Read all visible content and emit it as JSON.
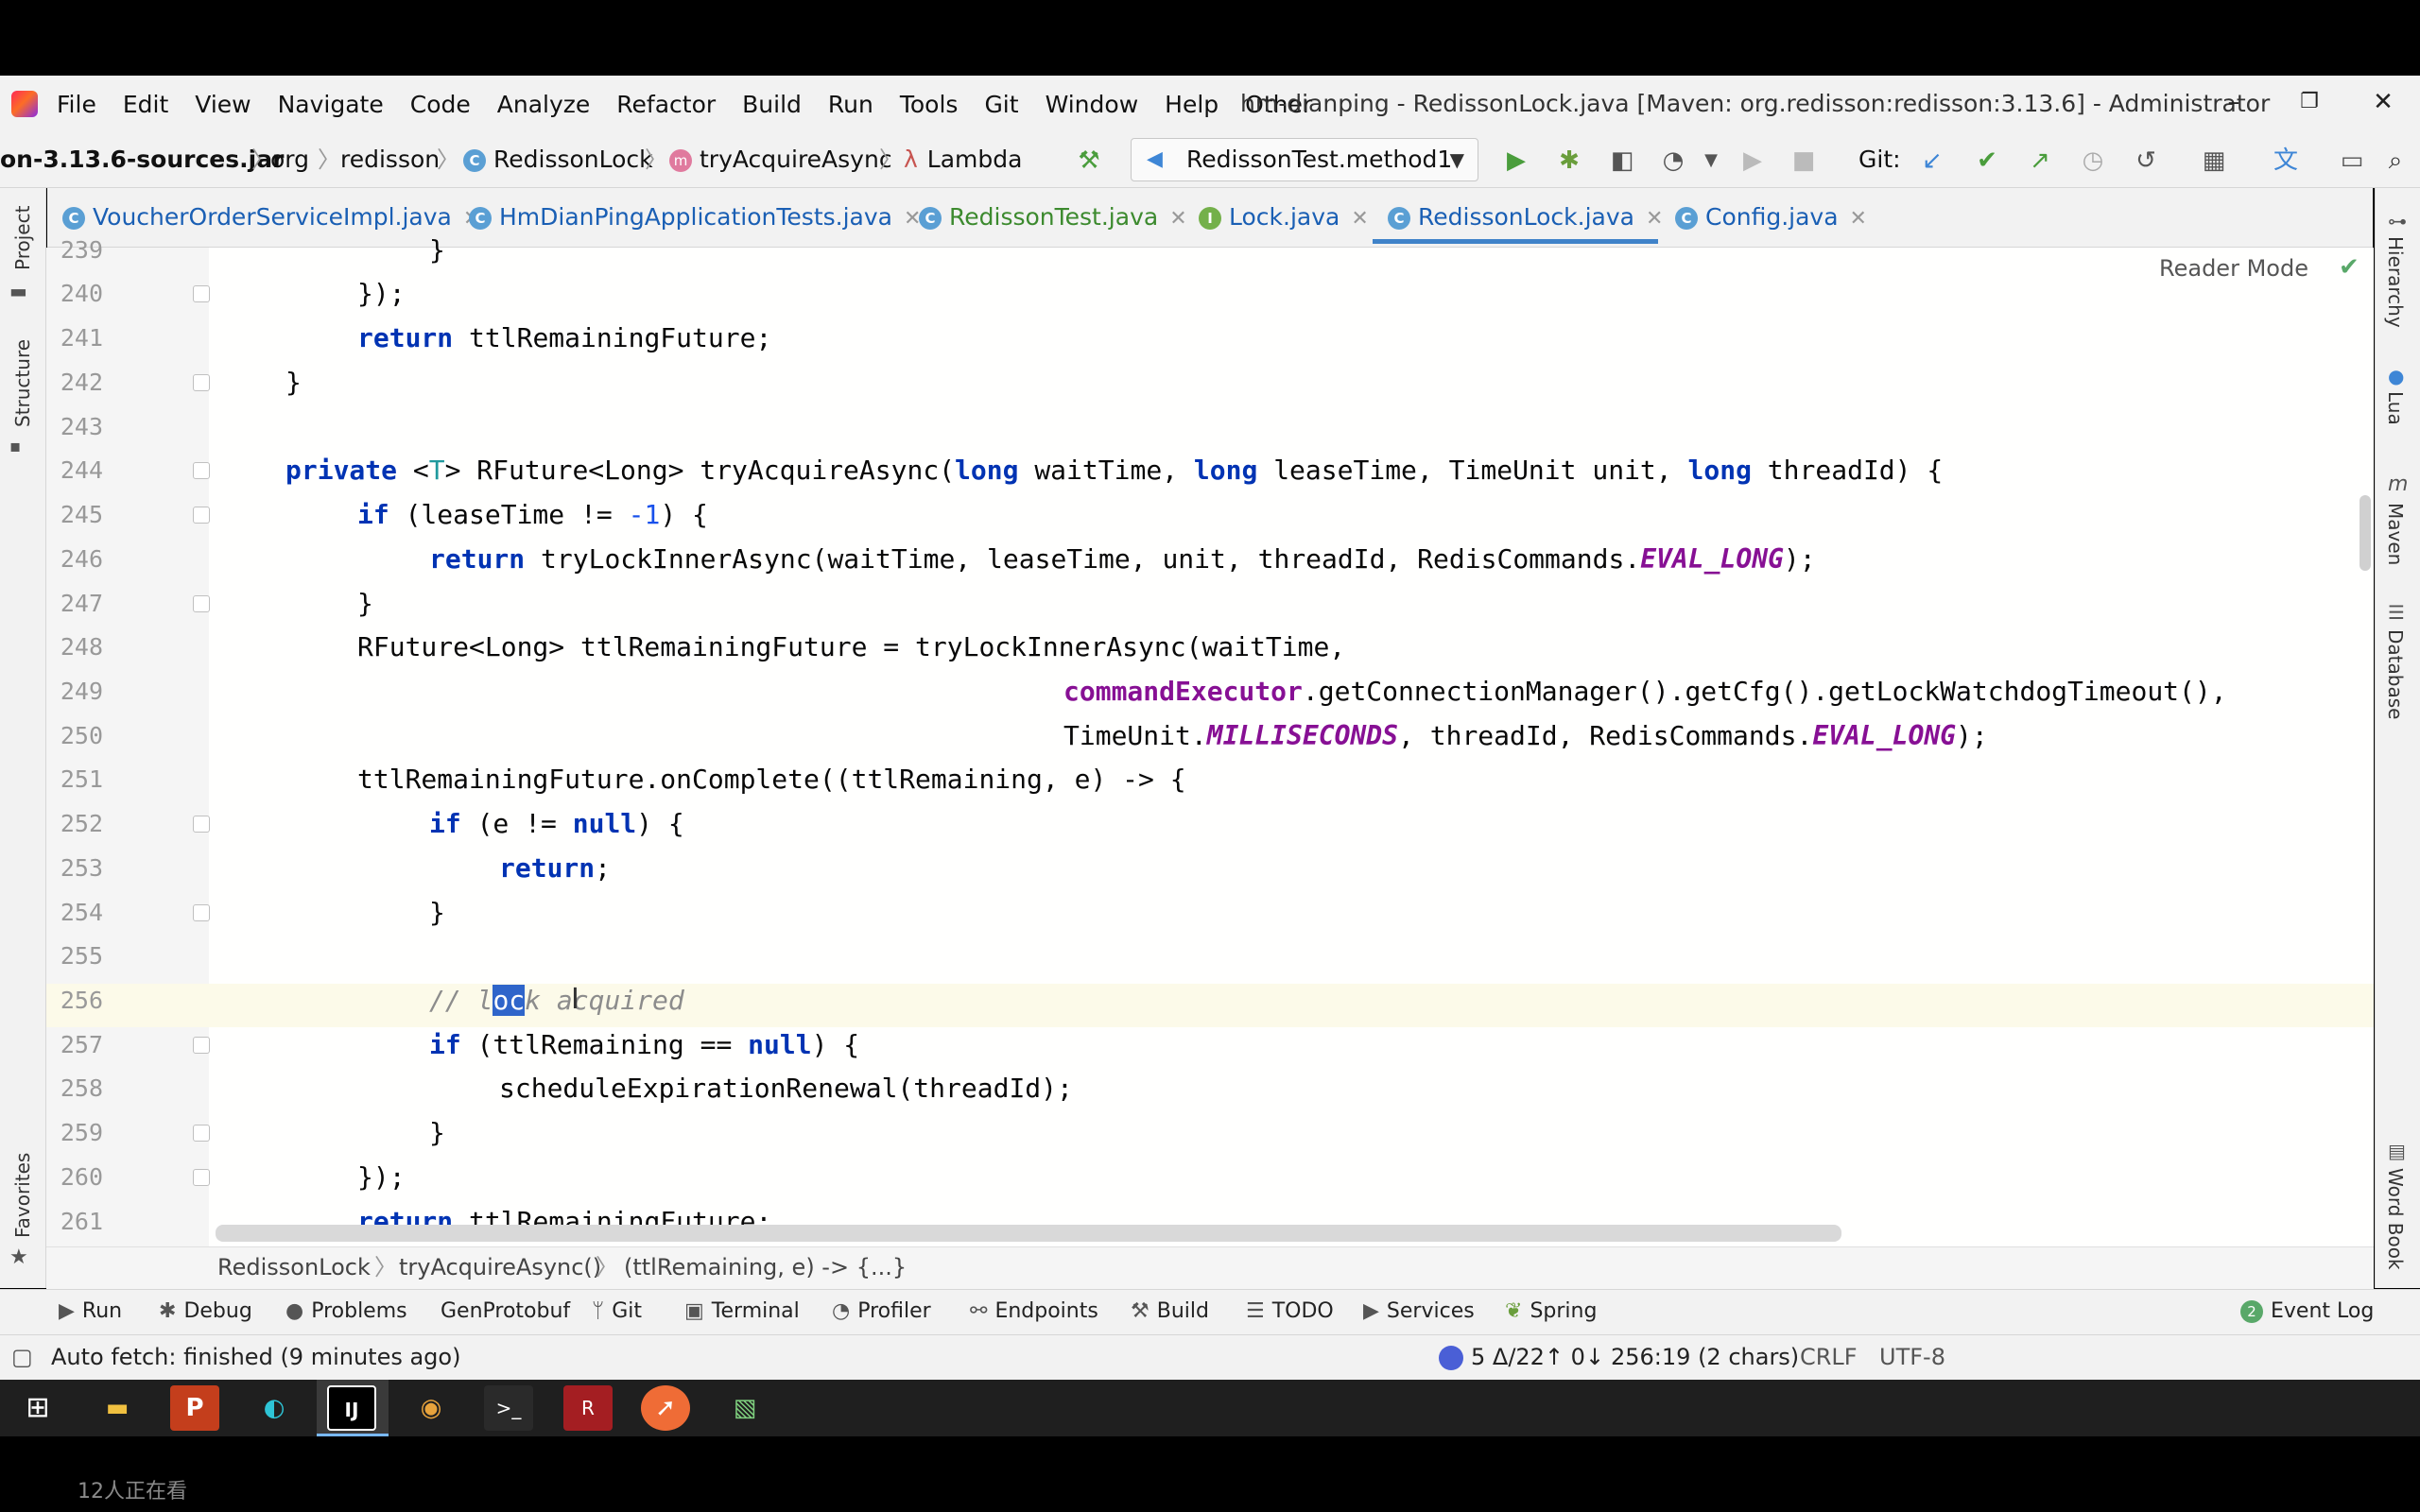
{
  "window": {
    "title": "hm-dianping - RedissonLock.java [Maven: org.redisson:redisson:3.13.6] - Administrator",
    "menu": [
      "File",
      "Edit",
      "View",
      "Navigate",
      "Code",
      "Analyze",
      "Refactor",
      "Build",
      "Run",
      "Tools",
      "Git",
      "Window",
      "Help",
      "Other"
    ]
  },
  "navbar": {
    "crumbs": [
      "on-3.13.6-sources.jar",
      "org",
      "redisson",
      "RedissonLock",
      "tryAcquireAsync",
      "Lambda"
    ],
    "run_config": "RedissonTest.method1",
    "git_label": "Git:"
  },
  "tabs": [
    {
      "label": "VoucherOrderServiceImpl.java",
      "color": "#1a5fb4"
    },
    {
      "label": "HmDianPingApplicationTests.java",
      "color": "#1a5fb4"
    },
    {
      "label": "RedissonTest.java",
      "color": "#3c8a2e"
    },
    {
      "label": "Lock.java",
      "color": "#1a5fb4"
    },
    {
      "label": "RedissonLock.java",
      "color": "#1a5fb4"
    },
    {
      "label": "Config.java",
      "color": "#1a5fb4"
    }
  ],
  "side": {
    "left": [
      "Project",
      "Structure",
      "Favorites"
    ],
    "right": [
      "Hierarchy",
      "Lua",
      "Maven",
      "Database",
      "Word Book"
    ]
  },
  "editor": {
    "reader_mode": "Reader Mode",
    "line_numbers": [
      "239",
      "240",
      "241",
      "242",
      "243",
      "244",
      "245",
      "246",
      "247",
      "248",
      "249",
      "250",
      "251",
      "252",
      "253",
      "254",
      "255",
      "256",
      "257",
      "258",
      "259",
      "260",
      "261"
    ],
    "code": {
      "l239": "}",
      "l240": "});",
      "l241_kw": "return",
      "l241_rest": " ttlRemainingFuture;",
      "l242": "}",
      "l244_kw": "private",
      "l244_t1": " <",
      "l244_T": "T",
      "l244_t2": "> RFuture<Long> tryAcquireAsync(",
      "l244_long1": "long",
      "l244_t3": " waitTime, ",
      "l244_long2": "long",
      "l244_t4": " leaseTime, TimeUnit unit, ",
      "l244_long3": "long",
      "l244_t5": " threadId) {",
      "l245_if": "if",
      "l245_t1": " (leaseTime != ",
      "l245_num": "-1",
      "l245_t2": ") {",
      "l246_kw": "return",
      "l246_t1": " tryLockInnerAsync(waitTime, leaseTime, unit, threadId, RedisCommands.",
      "l246_it": "EVAL_LONG",
      "l246_t2": ");",
      "l247": "}",
      "l248": "RFuture<Long> ttlRemainingFuture = tryLockInnerAsync(waitTime,",
      "l249_fld": "commandExecutor",
      "l249_rest": ".getConnectionManager().getCfg().getLockWatchdogTimeout(),",
      "l250_t1": "TimeUnit.",
      "l250_it1": "MILLISECONDS",
      "l250_t2": ", threadId, RedisCommands.",
      "l250_it2": "EVAL_LONG",
      "l250_t3": ");",
      "l251": "ttlRemainingFuture.onComplete((ttlRemaining, e) -> {",
      "l252_if": "if",
      "l252_t1": " (e != ",
      "l252_null": "null",
      "l252_t2": ") {",
      "l253_kw": "return",
      "l253_t": ";",
      "l254": "}",
      "l256_c1": "// l",
      "l256_sel": "oc",
      "l256_c2": "k acquired",
      "l257_if": "if",
      "l257_t1": " (ttlRemaining == ",
      "l257_null": "null",
      "l257_t2": ") {",
      "l258": "scheduleExpirationRenewal(threadId);",
      "l259": "}",
      "l260": "});",
      "l261_kw": "return",
      "l261_rest": " ttlRemainingFuture;"
    },
    "breadcrumbs": [
      "RedissonLock",
      "tryAcquireAsync()",
      "(ttlRemaining, e) -> {...}"
    ]
  },
  "tool_windows": [
    "Run",
    "Debug",
    "Problems",
    "GenProtobuf",
    "Git",
    "Terminal",
    "Profiler",
    "Endpoints",
    "Build",
    "TODO",
    "Services",
    "Spring"
  ],
  "event_log": {
    "count": "2",
    "label": "Event Log"
  },
  "status": {
    "message": "Auto fetch: finished (9 minutes ago)",
    "git": "5 Δ/22↑ 0↓",
    "position": "256:19 (2 chars)",
    "line_sep": "CRLF",
    "encoding": "UTF-8"
  },
  "overlay": {
    "viewers": "12人正在看"
  },
  "colors": {
    "accent": "#4083c9",
    "selection": "#2f65ca",
    "keyword": "#0033b3",
    "field": "#871094"
  }
}
